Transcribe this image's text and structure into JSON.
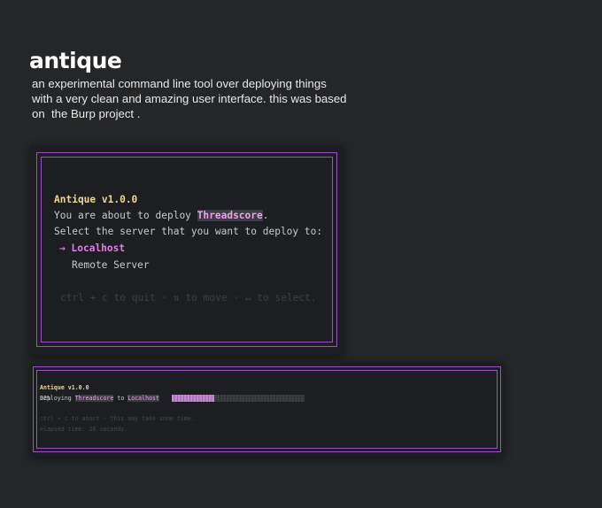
{
  "header": {
    "title": "antique",
    "description_lines": [
      "an experimental command line tool over deploying things",
      "with a very clean and amazing user interface. this was based",
      "on  the Burp project ."
    ]
  },
  "terminal1": {
    "title": "Antique v1.0.0",
    "deploy_prefix": "You are about to deploy ",
    "project": "Threadscore",
    "deploy_suffix": ".",
    "select_prompt": "Select the server that you want to deploy to:",
    "selected_marker": "→",
    "options": [
      "Localhost",
      "Remote Server"
    ],
    "help": "ctrl + c to quit · ⇅ to move · ↵ to select."
  },
  "terminal2": {
    "title": "Antique v1.0.0",
    "deploy_prefix": "Deploying ",
    "project": "Threadscore",
    "to": " to ",
    "target": "Localhost",
    "progress": 0.32,
    "progress_label": "32%",
    "abort_hint": "ctrl + c to abort · this may take some time.",
    "elapsed": "elapsed time: 26 seconds."
  },
  "colors": {
    "background": "#252628",
    "terminal_bg": "#1d1e21",
    "frame": "#9c4fc6",
    "title_yellow": "#f0d693",
    "accent_pink": "#e57be8"
  }
}
